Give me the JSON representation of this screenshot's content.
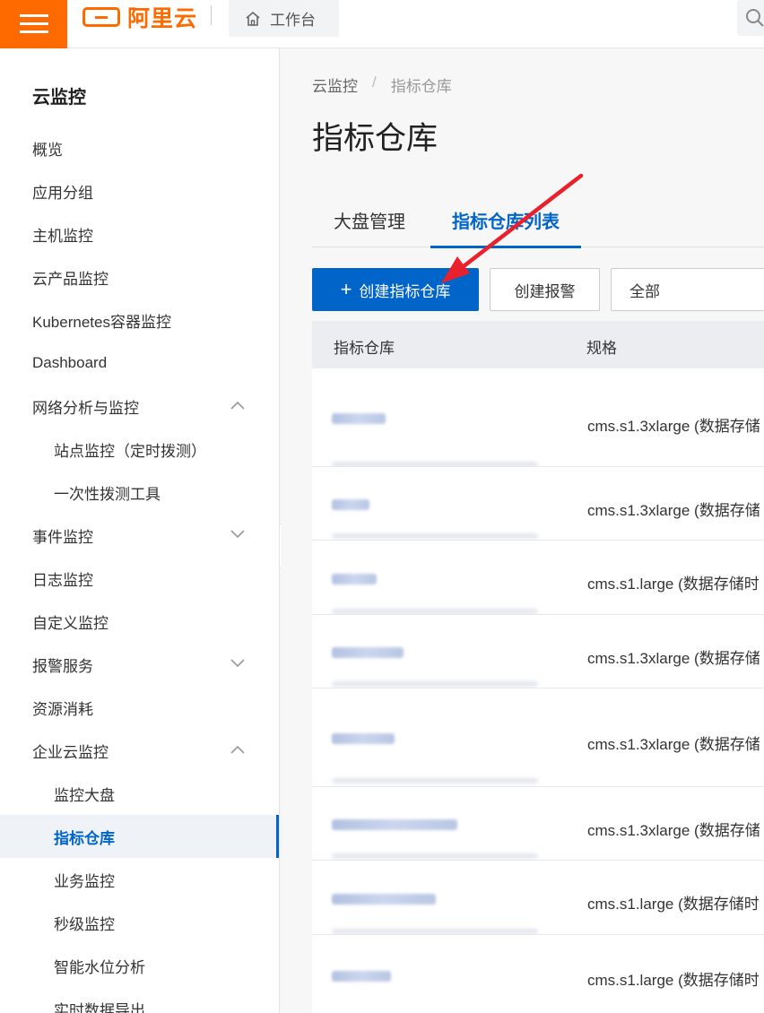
{
  "topbar": {
    "logo_text": "阿里云",
    "workbench_label": "工作台"
  },
  "sidebar": {
    "title": "云监控",
    "items": [
      {
        "label": "概览"
      },
      {
        "label": "应用分组"
      },
      {
        "label": "主机监控"
      },
      {
        "label": "云产品监控"
      },
      {
        "label": "Kubernetes容器监控"
      },
      {
        "label": "Dashboard"
      },
      {
        "label": "网络分析与监控"
      },
      {
        "label": "站点监控（定时拨测）"
      },
      {
        "label": "一次性拨测工具"
      },
      {
        "label": "事件监控"
      },
      {
        "label": "日志监控"
      },
      {
        "label": "自定义监控"
      },
      {
        "label": "报警服务"
      },
      {
        "label": "资源消耗"
      },
      {
        "label": "企业云监控"
      },
      {
        "label": "监控大盘"
      },
      {
        "label": "指标仓库"
      },
      {
        "label": "业务监控"
      },
      {
        "label": "秒级监控"
      },
      {
        "label": "智能水位分析"
      },
      {
        "label": "实时数据导出"
      }
    ]
  },
  "main": {
    "breadcrumb": {
      "root": "云监控",
      "separator": "/",
      "current": "指标仓库"
    },
    "title": "指标仓库",
    "tabs": [
      {
        "label": "大盘管理"
      },
      {
        "label": "指标仓库列表"
      }
    ],
    "toolbar": {
      "create_button_icon": "+",
      "create_button": "创建指标仓库",
      "alarm_button": "创建报警",
      "filter_value": "全部"
    },
    "table": {
      "columns": [
        "指标仓库",
        "规格"
      ],
      "rows": [
        {
          "spec": "cms.s1.3xlarge (数据存储"
        },
        {
          "spec": "cms.s1.3xlarge (数据存储"
        },
        {
          "spec": "cms.s1.large (数据存储时"
        },
        {
          "spec": "cms.s1.3xlarge (数据存储"
        },
        {
          "spec": "cms.s1.3xlarge (数据存储"
        },
        {
          "spec": "cms.s1.3xlarge (数据存储"
        },
        {
          "spec": "cms.s1.large (数据存储时"
        },
        {
          "spec": "cms.s1.large (数据存储时"
        }
      ]
    }
  },
  "colors": {
    "brand_orange": "#ff6a00",
    "primary_blue": "#0064c8",
    "annotation_arrow": "#e8212d"
  }
}
